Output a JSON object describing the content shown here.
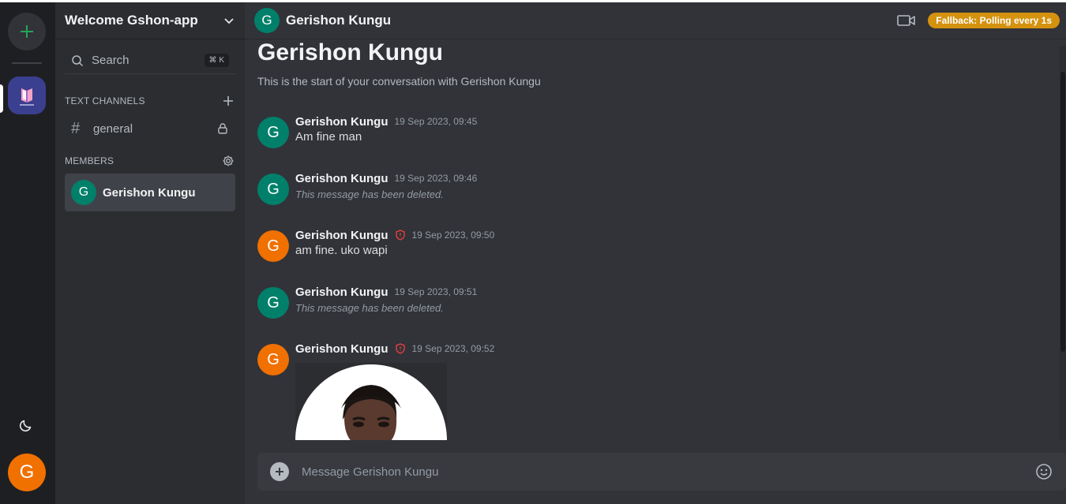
{
  "rail": {
    "add_icon": "plus-icon",
    "server_icon": "book-logo",
    "theme_icon": "moon-icon",
    "user_initial": "G"
  },
  "sidebar": {
    "server_name": "Welcome Gshon-app",
    "search_label": "Search",
    "search_shortcut": "⌘ K",
    "text_channels_title": "TEXT CHANNELS",
    "channels": [
      {
        "name": "general",
        "locked": true
      }
    ],
    "members_title": "MEMBERS",
    "members": [
      {
        "initial": "G",
        "name": "Gerishon Kungu"
      }
    ]
  },
  "header": {
    "initial": "G",
    "name": "Gerishon Kungu",
    "fallback_badge": "Fallback: Polling every 1s"
  },
  "conversation": {
    "title": "Gerishon Kungu",
    "subtitle": "This is the start of your conversation with Gerishon Kungu"
  },
  "messages": [
    {
      "initial": "G",
      "author": "Gerishon Kungu",
      "time": "19 Sep 2023, 09:45",
      "text": "Am fine man",
      "deleted": false,
      "shield": false,
      "color": "#00806a"
    },
    {
      "initial": "G",
      "author": "Gerishon Kungu",
      "time": "19 Sep 2023, 09:46",
      "text": "This message has been deleted.",
      "deleted": true,
      "shield": false,
      "color": "#00806a"
    },
    {
      "initial": "G",
      "author": "Gerishon Kungu",
      "time": "19 Sep 2023, 09:50",
      "text": "am fine. uko wapi",
      "deleted": false,
      "shield": true,
      "color": "#f07000"
    },
    {
      "initial": "G",
      "author": "Gerishon Kungu",
      "time": "19 Sep 2023, 09:51",
      "text": "This message has been deleted.",
      "deleted": true,
      "shield": false,
      "color": "#00806a"
    },
    {
      "initial": "G",
      "author": "Gerishon Kungu",
      "time": "19 Sep 2023, 09:52",
      "text": "",
      "deleted": false,
      "shield": true,
      "color": "#f07000",
      "attachment": "profile-photo"
    }
  ],
  "composer": {
    "placeholder": "Message Gerishon Kungu"
  },
  "colors": {
    "teal_avatar": "#00806a",
    "orange_avatar": "#f07000",
    "fallback_badge": "#d4920f",
    "add_server_accent": "#23a559",
    "shield": "#f23f43"
  }
}
